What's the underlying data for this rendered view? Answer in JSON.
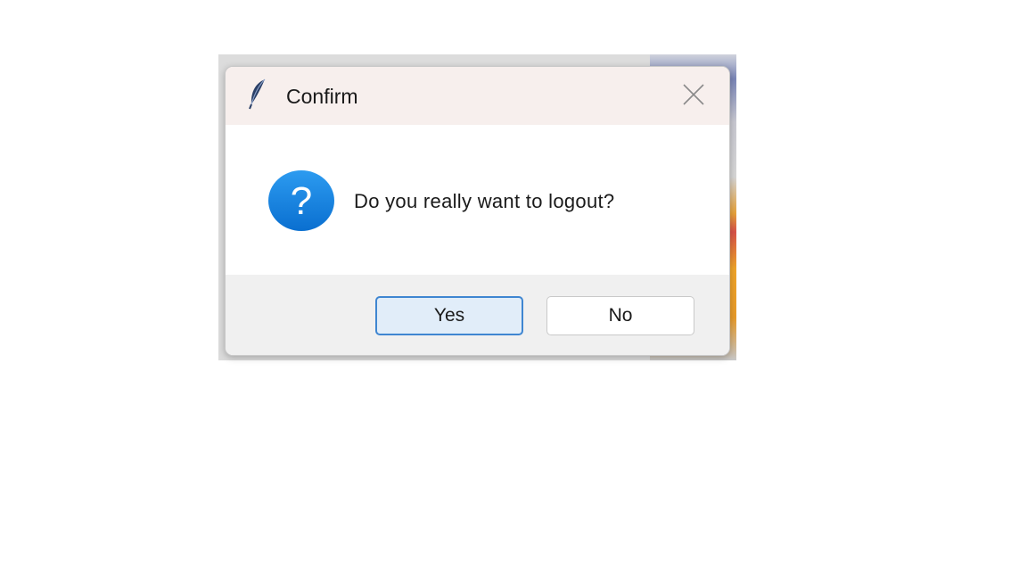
{
  "dialog": {
    "title": "Confirm",
    "message": "Do you really want to logout?",
    "icon": "question-icon",
    "app_icon": "feather-icon",
    "close_icon": "close-icon",
    "buttons": {
      "yes_label": "Yes",
      "no_label": "No",
      "default": "Yes"
    },
    "colors": {
      "titlebar": "#f7efed",
      "question_icon": "#1a8ae6",
      "default_button_border": "#3f86d1",
      "default_button_bg": "#e1edf9"
    }
  }
}
